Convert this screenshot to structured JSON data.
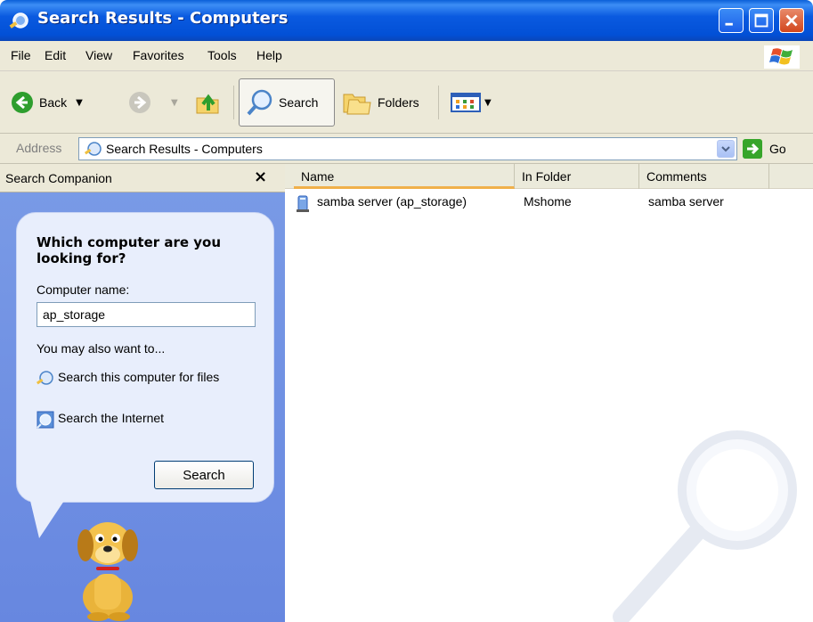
{
  "window": {
    "title": "Search Results - Computers"
  },
  "menu": [
    "File",
    "Edit",
    "View",
    "Favorites",
    "Tools",
    "Help"
  ],
  "toolbar": {
    "back_label": "Back",
    "search_label": "Search",
    "folders_label": "Folders"
  },
  "address": {
    "label": "Address",
    "value": "Search Results - Computers",
    "go_label": "Go"
  },
  "companion": {
    "title": "Search Companion",
    "question": "Which computer are you looking for?",
    "field_label": "Computer name:",
    "computer_name": "ap_storage",
    "also_label": "You may also want to...",
    "links": [
      "Search this computer for files",
      "Search the Internet"
    ],
    "search_button": "Search"
  },
  "results": {
    "columns": [
      "Name",
      "In Folder",
      "Comments"
    ],
    "rows": [
      {
        "name": "samba server (ap_storage)",
        "folder": "Mshome",
        "comments": "samba server"
      }
    ]
  }
}
